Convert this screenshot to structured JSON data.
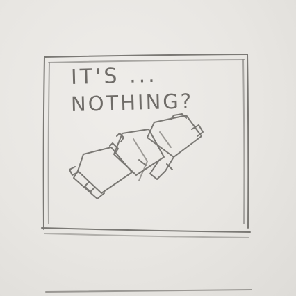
{
  "caption": {
    "line1": "IT'S ...",
    "line2": "NOTHING?"
  },
  "drawing": {
    "frame_icon": "sketch-panel-frame",
    "object_icon": "broken-brick-pieces-icon",
    "stroke_color": "#7a7874",
    "paper_color": "#e9e7e3"
  }
}
